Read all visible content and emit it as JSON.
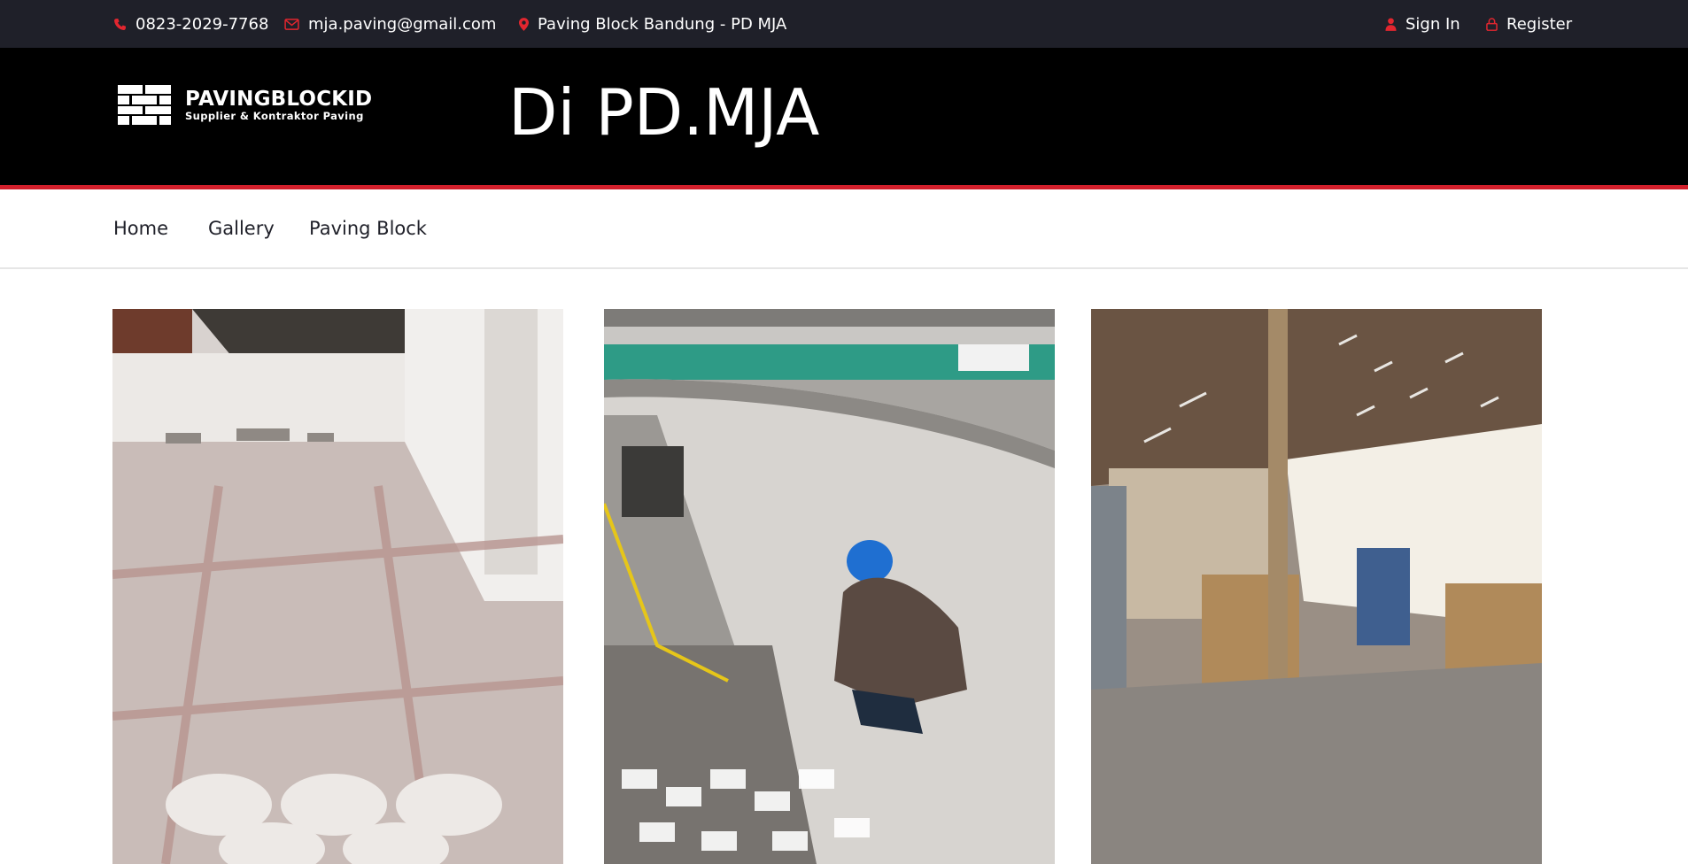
{
  "topbar": {
    "phone": "0823-2029-7768",
    "email": "mja.paving@gmail.com",
    "location": "Paving Block Bandung - PD MJA",
    "sign_in": "Sign In",
    "register": "Register",
    "icons": [
      "phone-icon",
      "envelope-icon",
      "map-marker-icon",
      "user-icon",
      "lock-icon"
    ],
    "accent_color": "#e2262f",
    "background_color": "#1f2029"
  },
  "header": {
    "logo_title": "PAVINGBLOCKID",
    "logo_subtitle": "Supplier & Kontraktor Paving",
    "title": "Di PD.MJA",
    "background_color": "#000000",
    "underline_color": "#d21f2b"
  },
  "nav": {
    "items": [
      {
        "label": "Home"
      },
      {
        "label": "Gallery"
      },
      {
        "label": "Paving Block"
      }
    ]
  },
  "gallery": {
    "images": [
      {
        "subject": "paved-courtyard-photo"
      },
      {
        "subject": "paving-worker-photo"
      },
      {
        "subject": "paving-warehouse-photo"
      }
    ]
  }
}
